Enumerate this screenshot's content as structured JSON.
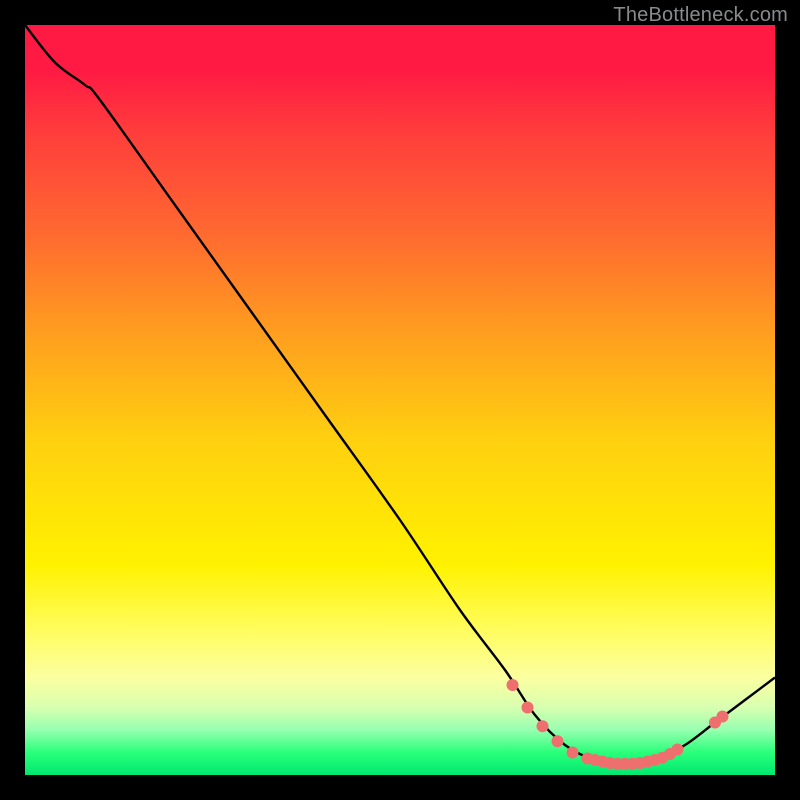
{
  "attribution": "TheBottleneck.com",
  "colors": {
    "line": "#000000",
    "marker_fill": "#ef6f6f"
  },
  "chart_data": {
    "type": "line",
    "title": "",
    "xlabel": "",
    "ylabel": "",
    "x_range": [
      0,
      100
    ],
    "y_range": [
      0,
      100
    ],
    "curve": [
      {
        "x": 0,
        "y": 100
      },
      {
        "x": 4,
        "y": 95
      },
      {
        "x": 8,
        "y": 92
      },
      {
        "x": 10,
        "y": 90
      },
      {
        "x": 20,
        "y": 76
      },
      {
        "x": 30,
        "y": 62
      },
      {
        "x": 40,
        "y": 48
      },
      {
        "x": 50,
        "y": 34
      },
      {
        "x": 58,
        "y": 22
      },
      {
        "x": 64,
        "y": 14
      },
      {
        "x": 68,
        "y": 8
      },
      {
        "x": 72,
        "y": 4
      },
      {
        "x": 76,
        "y": 2
      },
      {
        "x": 80,
        "y": 1.5
      },
      {
        "x": 84,
        "y": 2
      },
      {
        "x": 88,
        "y": 4
      },
      {
        "x": 92,
        "y": 7
      },
      {
        "x": 96,
        "y": 10
      },
      {
        "x": 100,
        "y": 13
      }
    ],
    "markers": [
      {
        "x": 65,
        "y": 12
      },
      {
        "x": 67,
        "y": 9
      },
      {
        "x": 69,
        "y": 6.5
      },
      {
        "x": 71,
        "y": 4.5
      },
      {
        "x": 73,
        "y": 3
      },
      {
        "x": 75,
        "y": 2.2
      },
      {
        "x": 76,
        "y": 2
      },
      {
        "x": 77,
        "y": 1.8
      },
      {
        "x": 78,
        "y": 1.6
      },
      {
        "x": 79,
        "y": 1.5
      },
      {
        "x": 80,
        "y": 1.5
      },
      {
        "x": 81,
        "y": 1.5
      },
      {
        "x": 82,
        "y": 1.6
      },
      {
        "x": 83,
        "y": 1.8
      },
      {
        "x": 84,
        "y": 2
      },
      {
        "x": 85,
        "y": 2.3
      },
      {
        "x": 86,
        "y": 2.8
      },
      {
        "x": 87,
        "y": 3.4
      },
      {
        "x": 92,
        "y": 7
      },
      {
        "x": 93,
        "y": 7.8
      }
    ]
  }
}
